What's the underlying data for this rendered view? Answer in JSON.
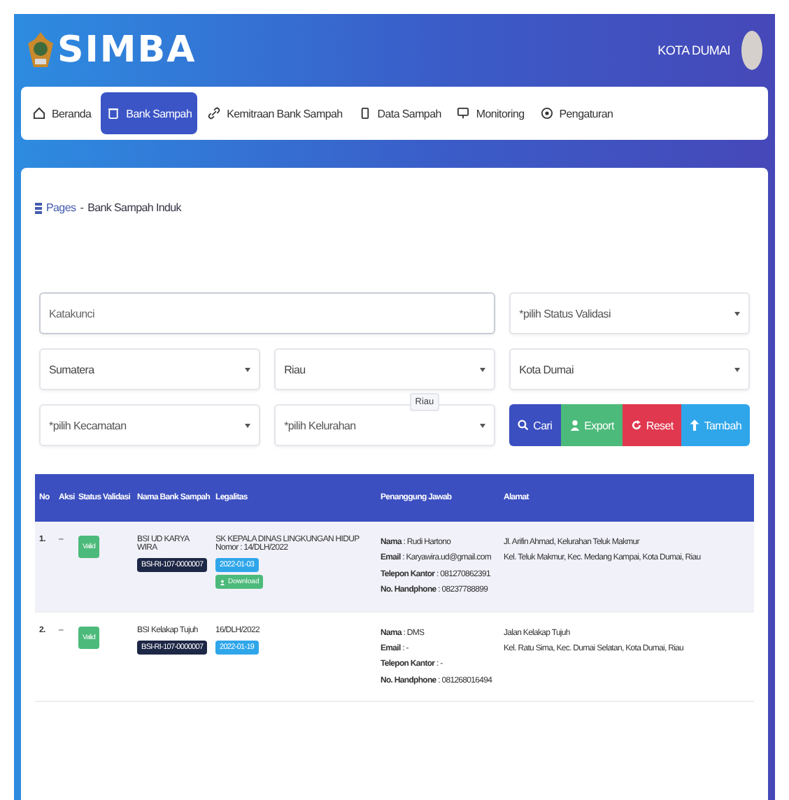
{
  "header": {
    "logo": "SIMBA",
    "user": "KOTA DUMAI"
  },
  "nav": [
    {
      "label": "Beranda",
      "selected": false
    },
    {
      "label": "Bank Sampah",
      "selected": true
    },
    {
      "label": "Kemitraan Bank Sampah",
      "selected": false
    },
    {
      "label": "Data Sampah",
      "selected": false
    },
    {
      "label": "Monitoring",
      "selected": false
    },
    {
      "label": "Pengaturan",
      "selected": false
    }
  ],
  "breadcrumb": [
    "Pages",
    "-",
    "Bank Sampah Induk"
  ],
  "filters": {
    "keyword": {
      "placeholder": "Katakunci"
    },
    "selects": [
      {
        "placeholder": "*pilih Status Validasi"
      },
      {
        "value": "Sumatera"
      },
      {
        "value": "Riau"
      },
      {
        "value": "Kota Dumai"
      },
      {
        "placeholder": "*pilih Kecamatan"
      },
      {
        "placeholder": "*pilih Kelurahan"
      }
    ],
    "tooltip": "Riau",
    "buttons": [
      {
        "label": "Cari",
        "kind": "search"
      },
      {
        "label": "Export",
        "kind": "export"
      },
      {
        "label": "Reset",
        "kind": "reset"
      },
      {
        "label": "Tambah",
        "kind": "add"
      }
    ]
  },
  "table": {
    "columns": [
      "No",
      "Aksi",
      "Status Validasi",
      "Nama Bank Sampah",
      "Legalitas",
      "Penanggung Jawab",
      "Alamat"
    ],
    "rows": [
      {
        "selected": true,
        "no": "1.",
        "action": "–",
        "status": "Valid",
        "name": "BSI UD KARYA WIRA",
        "code": "BSI-RI-107-0000007",
        "legal": "SK KEPALA DINAS LINGKUNGAN HIDUP Nomor : 14/DLH/2022",
        "date": "2022-01-03",
        "download": "Download",
        "contact": [
          "**Nama** : Rudi Hartono",
          "**Email** : Karyawira.ud@gmail.com",
          "**Telepon Kantor** : 081270862391",
          "**No. Handphone** : 08237788899"
        ],
        "address": [
          "Jl. Arifin Ahmad, Kelurahan Teluk Makmur",
          "Kel. Teluk Makmur, Kec. Medang Kampai, Kota Dumai, Riau"
        ]
      },
      {
        "selected": false,
        "no": "2.",
        "action": "–",
        "status": "Valid",
        "name": "BSI Kelakap Tujuh",
        "code": "BSI-RI-107-0000007",
        "legal": "16/DLH/2022",
        "date": "2022-01-19",
        "contact": [
          "**Nama** : DMS",
          "**Email** : -",
          "**Telepon Kantor** : -",
          "**No. Handphone** : 081268016494"
        ],
        "address": [
          "Jalan Kelakap Tujuh",
          "Kel. Ratu Sima, Kec. Dumai Selatan, Kota Dumai, Riau"
        ]
      }
    ]
  }
}
